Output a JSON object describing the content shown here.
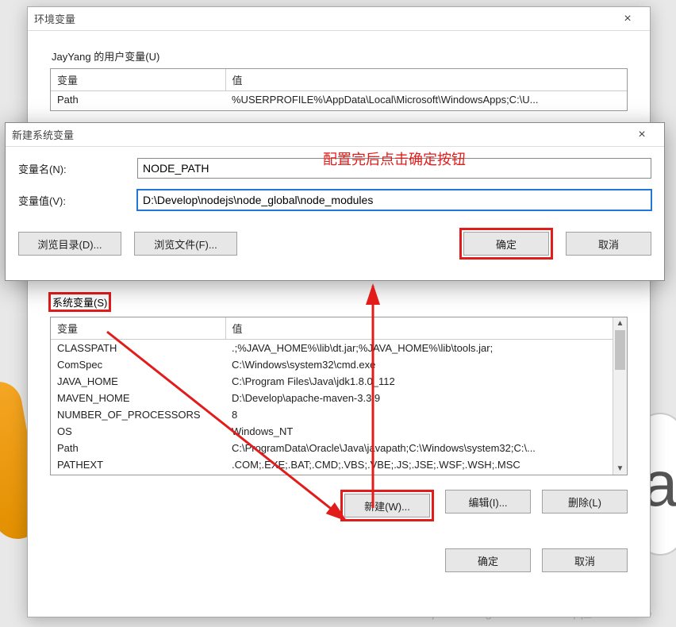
{
  "envDialog": {
    "title": "环境变量",
    "userSectionLabel": "JayYang 的用户变量(U)",
    "columns": {
      "var": "变量",
      "val": "值"
    },
    "userVars": [
      {
        "name": "Path",
        "value": "%USERPROFILE%\\AppData\\Local\\Microsoft\\WindowsApps;C:\\U..."
      }
    ],
    "sysSectionLabel": "系统变量(S)",
    "sysVars": [
      {
        "name": "CLASSPATH",
        "value": ".;%JAVA_HOME%\\lib\\dt.jar;%JAVA_HOME%\\lib\\tools.jar;"
      },
      {
        "name": "ComSpec",
        "value": "C:\\Windows\\system32\\cmd.exe"
      },
      {
        "name": "JAVA_HOME",
        "value": "C:\\Program Files\\Java\\jdk1.8.0_112"
      },
      {
        "name": "MAVEN_HOME",
        "value": "D:\\Develop\\apache-maven-3.3.9"
      },
      {
        "name": "NUMBER_OF_PROCESSORS",
        "value": "8"
      },
      {
        "name": "OS",
        "value": "Windows_NT"
      },
      {
        "name": "Path",
        "value": "C:\\ProgramData\\Oracle\\Java\\javapath;C:\\Windows\\system32;C:\\..."
      },
      {
        "name": "PATHEXT",
        "value": ".COM;.EXE;.BAT;.CMD;.VBS;.VBE;.JS;.JSE;.WSF;.WSH;.MSC"
      }
    ],
    "buttons": {
      "new": "新建(W)...",
      "edit": "编辑(I)...",
      "delete": "删除(L)",
      "ok": "确定",
      "cancel": "取消"
    }
  },
  "newDialog": {
    "title": "新建系统变量",
    "nameLabel": "变量名(N):",
    "valueLabel": "变量值(V):",
    "nameValue": "NODE_PATH",
    "valueValue": "D:\\Develop\\nodejs\\node_global\\node_modules",
    "browseDir": "浏览目录(D)...",
    "browseFile": "浏览文件(F)...",
    "ok": "确定",
    "cancel": "取消"
  },
  "annotation": {
    "tip": "配置完后点击确定按钮",
    "watermark": "http://blog.csdn.net/qq_31059475"
  }
}
